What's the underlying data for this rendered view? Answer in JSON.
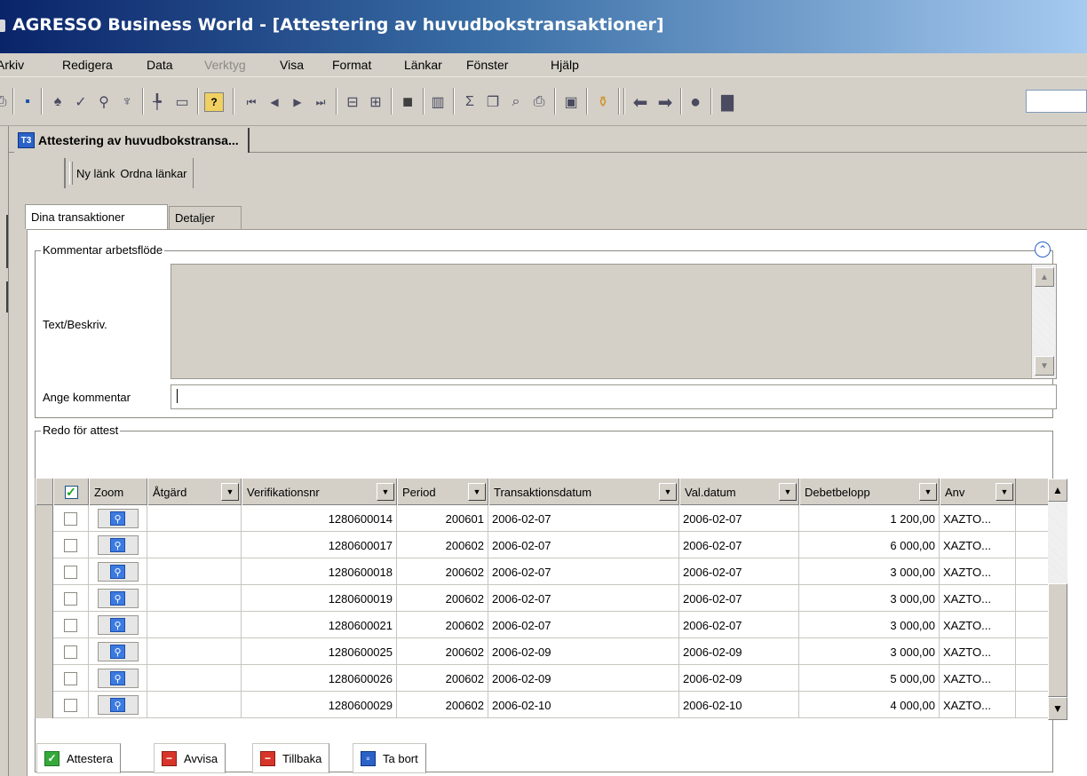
{
  "window": {
    "title": "AGRESSO Business World - [Attestering av huvudbokstransaktioner]"
  },
  "menu": [
    {
      "label": "Arkiv",
      "disabled": false
    },
    {
      "label": "Redigera",
      "disabled": false
    },
    {
      "label": "Data",
      "disabled": false
    },
    {
      "label": "Verktyg",
      "disabled": true
    },
    {
      "label": "Visa",
      "disabled": false
    },
    {
      "label": "Format",
      "disabled": false
    },
    {
      "label": "Länkar",
      "disabled": false
    },
    {
      "label": "Fönster",
      "disabled": false
    },
    {
      "label": "Hjälp",
      "disabled": false
    }
  ],
  "toolbar_icons": [
    "print-icon",
    "save-icon",
    "find-icon",
    "check-icon",
    "search-icon",
    "filter-icon",
    "insert-row-icon",
    "blank-icon",
    "help-icon",
    "first-icon",
    "previous-icon",
    "next-icon",
    "last-icon",
    "collapse-icon",
    "expand-icon",
    "black-square-icon",
    "chart-icon",
    "sum-icon",
    "copy-icon",
    "zoom-icon",
    "print-preview-icon",
    "window-icon",
    "bottles-icon",
    "back-arrow-icon",
    "forward-arrow-icon",
    "stop-icon",
    "note-icon"
  ],
  "doc_tab": {
    "icon_label": "T3",
    "label": "Attestering av huvudbokstransa..."
  },
  "links": {
    "new_link": "Ny länk",
    "arrange_links": "Ordna länkar"
  },
  "tabs": [
    {
      "label": "Dina transaktioner",
      "active": true
    },
    {
      "label": "Detaljer",
      "active": false
    }
  ],
  "workflow": {
    "legend": "Kommentar arbetsflöde",
    "text_label": "Text/Beskriv.",
    "comment_label": "Ange kommentar",
    "comment_value": ""
  },
  "grid": {
    "legend": "Redo för attest",
    "columns": [
      "Zoom",
      "Åtgärd",
      "Verifikationsnr",
      "Period",
      "Transaktionsdatum",
      "Val.datum",
      "Debetbelopp",
      "Anv"
    ],
    "rows": [
      {
        "checked": false,
        "action": "",
        "ver": "1280600014",
        "period": "200601",
        "trans_date": "2006-02-07",
        "val_date": "2006-02-07",
        "debit": "1 200,00",
        "user": "XAZTO..."
      },
      {
        "checked": false,
        "action": "",
        "ver": "1280600017",
        "period": "200602",
        "trans_date": "2006-02-07",
        "val_date": "2006-02-07",
        "debit": "6 000,00",
        "user": "XAZTO..."
      },
      {
        "checked": false,
        "action": "",
        "ver": "1280600018",
        "period": "200602",
        "trans_date": "2006-02-07",
        "val_date": "2006-02-07",
        "debit": "3 000,00",
        "user": "XAZTO..."
      },
      {
        "checked": false,
        "action": "",
        "ver": "1280600019",
        "period": "200602",
        "trans_date": "2006-02-07",
        "val_date": "2006-02-07",
        "debit": "3 000,00",
        "user": "XAZTO..."
      },
      {
        "checked": false,
        "action": "",
        "ver": "1280600021",
        "period": "200602",
        "trans_date": "2006-02-07",
        "val_date": "2006-02-07",
        "debit": "3 000,00",
        "user": "XAZTO..."
      },
      {
        "checked": false,
        "action": "",
        "ver": "1280600025",
        "period": "200602",
        "trans_date": "2006-02-09",
        "val_date": "2006-02-09",
        "debit": "3 000,00",
        "user": "XAZTO..."
      },
      {
        "checked": false,
        "action": "",
        "ver": "1280600026",
        "period": "200602",
        "trans_date": "2006-02-09",
        "val_date": "2006-02-09",
        "debit": "5 000,00",
        "user": "XAZTO..."
      },
      {
        "checked": false,
        "action": "",
        "ver": "1280600029",
        "period": "200602",
        "trans_date": "2006-02-10",
        "val_date": "2006-02-10",
        "debit": "4 000,00",
        "user": "XAZTO..."
      }
    ]
  },
  "actions": [
    {
      "label": "Attestera",
      "icon": "check-icon",
      "color": "#35a83a"
    },
    {
      "label": "Avvisa",
      "icon": "reject-icon",
      "color": "#d8352a"
    },
    {
      "label": "Tillbaka",
      "icon": "return-icon",
      "color": "#d8352a"
    },
    {
      "label": "Ta bort",
      "icon": "delete-icon",
      "color": "#2a62c8"
    }
  ]
}
